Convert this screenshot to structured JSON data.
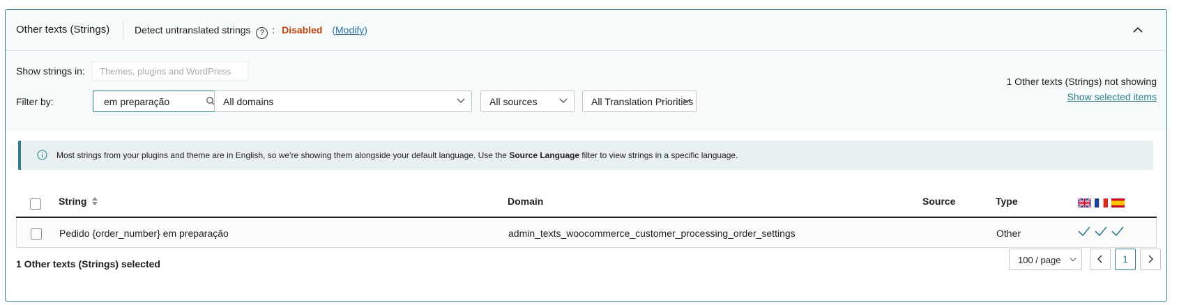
{
  "header": {
    "title": "Other texts (Strings)",
    "detect_label": "Detect untranslated strings",
    "help_glyph": "?",
    "colon": ":",
    "status": "Disabled",
    "modify_label": "Modify",
    "paren_open": "(",
    "paren_close": ")"
  },
  "filters": {
    "show_strings_label": "Show strings in:",
    "show_strings_placeholder": "Themes, plugins and WordPress",
    "filter_by_label": "Filter by:",
    "search_value": "em preparação",
    "domain_select": "All domains",
    "source_select": "All sources",
    "priority_select": "All Translation Priorities",
    "not_showing": "1 Other texts (Strings) not showing",
    "show_selected": "Show selected items"
  },
  "notice": {
    "text_before": "Most strings from your plugins and theme are in English, so we're showing them alongside your default language. Use the ",
    "bold": "Source Language",
    "text_after": " filter to view strings in a specific language."
  },
  "table": {
    "columns": [
      "String",
      "Domain",
      "Source",
      "Type"
    ],
    "languages": [
      "English",
      "French",
      "Spanish"
    ],
    "rows": [
      {
        "string": "Pedido {order_number} em preparação",
        "domain": "admin_texts_woocommerce_customer_processing_order_settings",
        "source": "",
        "type": "Other",
        "translated": [
          true,
          true,
          true
        ]
      }
    ]
  },
  "footer": {
    "selected_text": "1 Other texts (Strings) selected",
    "per_page": "100 / page",
    "current_page": "1"
  },
  "colors": {
    "accent": "#2f7d8a",
    "status_disabled": "#c2410c",
    "link": "#2a6fa8"
  }
}
